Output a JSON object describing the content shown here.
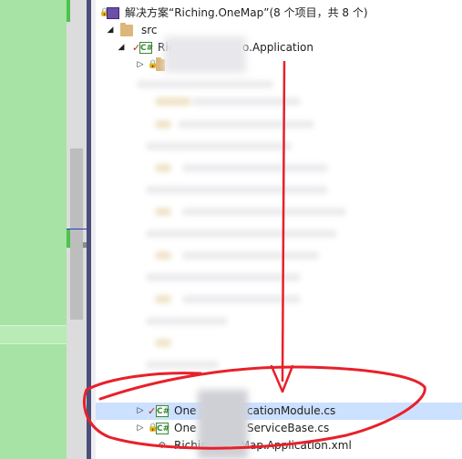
{
  "solution_explorer": {
    "solution_label": "解决方案“Riching.OneMap”(8 个项目，共 8 个)",
    "src_folder": "src",
    "project_name_start": "Rich",
    "project_name_end": "o.Application",
    "files": [
      {
        "name_start": "One",
        "name_end": "cationModule.cs",
        "selected": true
      },
      {
        "name_start": "One",
        "name_end": "ServiceBase.cs",
        "selected": false
      },
      {
        "name": "Riching.OneMap.Application.xml",
        "selected": false
      }
    ],
    "icons": {
      "csharp": "C#",
      "expand": "▷",
      "expanded": "◢",
      "checkmark": "✓",
      "lock": "🔒"
    }
  },
  "annotation": {
    "color": "#e8202a"
  }
}
